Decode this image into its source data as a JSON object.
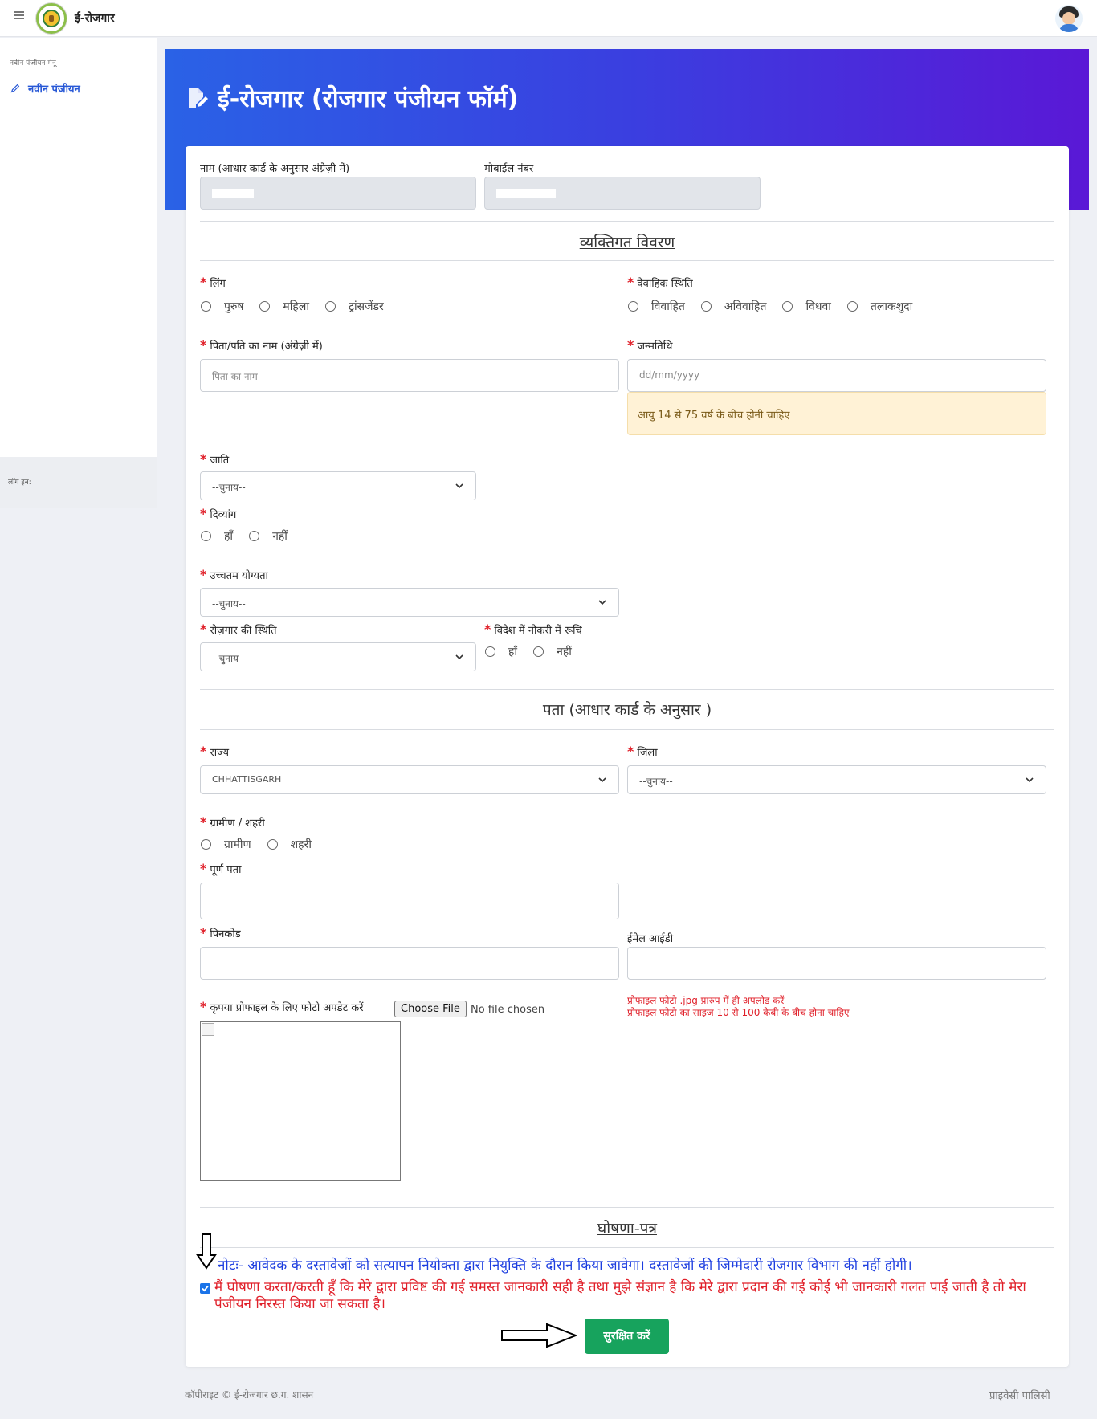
{
  "app": {
    "title": "ई-रोजगार"
  },
  "sidebar": {
    "heading": "नवीन पंजीयन मेनू",
    "items": [
      {
        "label": "नवीन पंजीयन"
      }
    ],
    "footer_label": "लॉग इन:"
  },
  "header": {
    "title": "ई-रोजगार (रोजगार पंजीयन फॉर्म)"
  },
  "form": {
    "name_label": "नाम (आधार कार्ड के अनुसार अंग्रेज़ी में)",
    "mobile_label": "मोबाईल नंबर",
    "personal_section": "व्यक्तिगत विवरण",
    "gender": {
      "label": "लिंग",
      "options": [
        "पुरुष",
        "महिला",
        "ट्रांसजेंडर"
      ]
    },
    "marital": {
      "label": "वैवाहिक स्थिति",
      "options": [
        "विवाहित",
        "अविवाहित",
        "विधवा",
        "तलाकशुदा"
      ]
    },
    "father_name": {
      "label": "पिता/पति का नाम (अंग्रेज़ी में)",
      "placeholder": "पिता का नाम"
    },
    "dob": {
      "label": "जन्मतिथि",
      "placeholder": "dd/mm/yyyy",
      "alert": "आयु 14 से 75 वर्ष के बीच होनी चाहिए"
    },
    "caste": {
      "label": "जाति",
      "selected": "--चुनाय--"
    },
    "disabled": {
      "label": "दिव्यांग",
      "options": [
        "हाँ",
        "नहीं"
      ]
    },
    "qualification": {
      "label": "उच्चतम योग्यता",
      "selected": "--चुनाय--"
    },
    "employment": {
      "label": "रोज़गार की स्थिति",
      "selected": "--चुनाय--"
    },
    "abroad": {
      "label": "विदेश में नौकरी में रूचि",
      "options": [
        "हाँ",
        "नहीं"
      ]
    },
    "address_section": "पता (आधार कार्ड के अनुसार )",
    "state": {
      "label": "राज्य",
      "selected": "CHHATTISGARH"
    },
    "district": {
      "label": "जिला",
      "selected": "--चुनाय--"
    },
    "area": {
      "label": "ग्रामीण / शहरी",
      "options": [
        "ग्रामीण",
        "शहरी"
      ]
    },
    "full_address": {
      "label": "पूर्ण पता"
    },
    "pincode": {
      "label": "पिनकोड"
    },
    "email": {
      "label": "ईमेल आईडी"
    },
    "photo": {
      "label": "कृपया प्रोफाइल के लिए फोटो अपडेट करें",
      "button": "Choose File",
      "status": "No file chosen",
      "note1": "प्रोफाइल फोटो .jpg प्रारुप में ही अपलोड करें",
      "note2": "प्रोफाइल फोटो का साइज 10 से 100 केबी के बीच होना चाहिए"
    },
    "declaration_section": "घोषणा-पत्र",
    "note": "नोटः- आवेदक के दस्तावेजों को सत्यापन नियोक्ता द्वारा नियुक्ति के दौरान किया जावेगा। दस्तावेजों की जिम्मेदारी रोजगार विभाग की नहीं होगी।",
    "declaration": "मैं घोषणा करता/करती हूँ कि मेरे द्वारा प्रविष्ट की गई समस्त जानकारी सही है तथा मुझे संज्ञान है कि मेरे द्वारा प्रदान की गई कोई भी जानकारी गलत पाई जाती है तो मेरा पंजीयन निरस्त किया जा सकता है।",
    "declaration_checked": true,
    "save_button": "सुरक्षित करें"
  },
  "footer": {
    "copyright": "कॉपीराइट © ई-रोजगार छ.ग. शासन",
    "privacy": "प्राइवेसी पालिसी"
  },
  "colors": {
    "accent": "#2858d6",
    "header_gradient_start": "#2a62e6",
    "header_gradient_end": "#5a18d6",
    "required": "#e0202a",
    "save": "#17a35d"
  }
}
